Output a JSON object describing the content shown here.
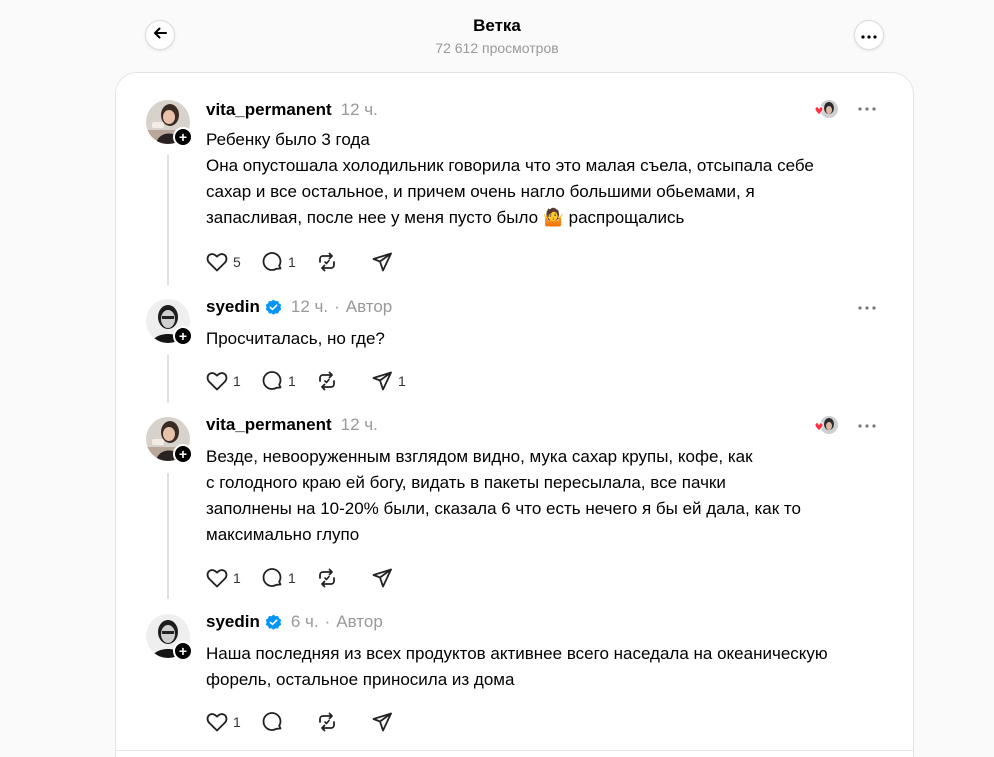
{
  "header": {
    "title": "Ветка",
    "views": "72 612 просмотров"
  },
  "posts": [
    {
      "username": "vita_permanent",
      "verified": false,
      "time": "12 ч.",
      "author_tag": "",
      "lines": [
        "Ребенку было 3 года",
        "Она опустошала холодильник говорила что это малая съела, отсыпала себе",
        "сахар и все остальное, и причем очень нагло большими обьемами, я",
        "запасливая, после нее у меня пусто было 🤷 распрощались"
      ],
      "likes": "5",
      "replies": "1",
      "reposts": "",
      "shares": ""
    },
    {
      "username": "syedin",
      "verified": true,
      "time": "12 ч.",
      "author_tag": "Автор",
      "lines": [
        "Просчиталась, но где?"
      ],
      "likes": "1",
      "replies": "1",
      "reposts": "",
      "shares": "1"
    },
    {
      "username": "vita_permanent",
      "verified": false,
      "time": "12 ч.",
      "author_tag": "",
      "lines": [
        "Везде, невооруженным взглядом видно, мука сахар крупы, кофе, как",
        "с голодного краю ей богу, видать в пакеты пересылала, все пачки",
        "заполнены на 10-20% были, сказала 6 что есть нечего я бы ей дала, как то",
        "максимально глупо"
      ],
      "likes": "1",
      "replies": "1",
      "reposts": "",
      "shares": ""
    },
    {
      "username": "syedin",
      "verified": true,
      "time": "6 ч.",
      "author_tag": "Автор",
      "lines": [
        "Наша последняя из всех продуктов активнее всего наседала на океаническую",
        "форель, остальное приносила из дома"
      ],
      "likes": "1",
      "replies": "",
      "reposts": "",
      "shares": ""
    }
  ],
  "colors": {
    "verified": "#0095f6",
    "heart": "#ff3040",
    "muted": "#999999"
  },
  "icons": [
    "back-arrow-icon",
    "more-icon",
    "heart-icon",
    "comment-icon",
    "repost-icon",
    "share-icon",
    "verified-icon",
    "plus-icon"
  ]
}
